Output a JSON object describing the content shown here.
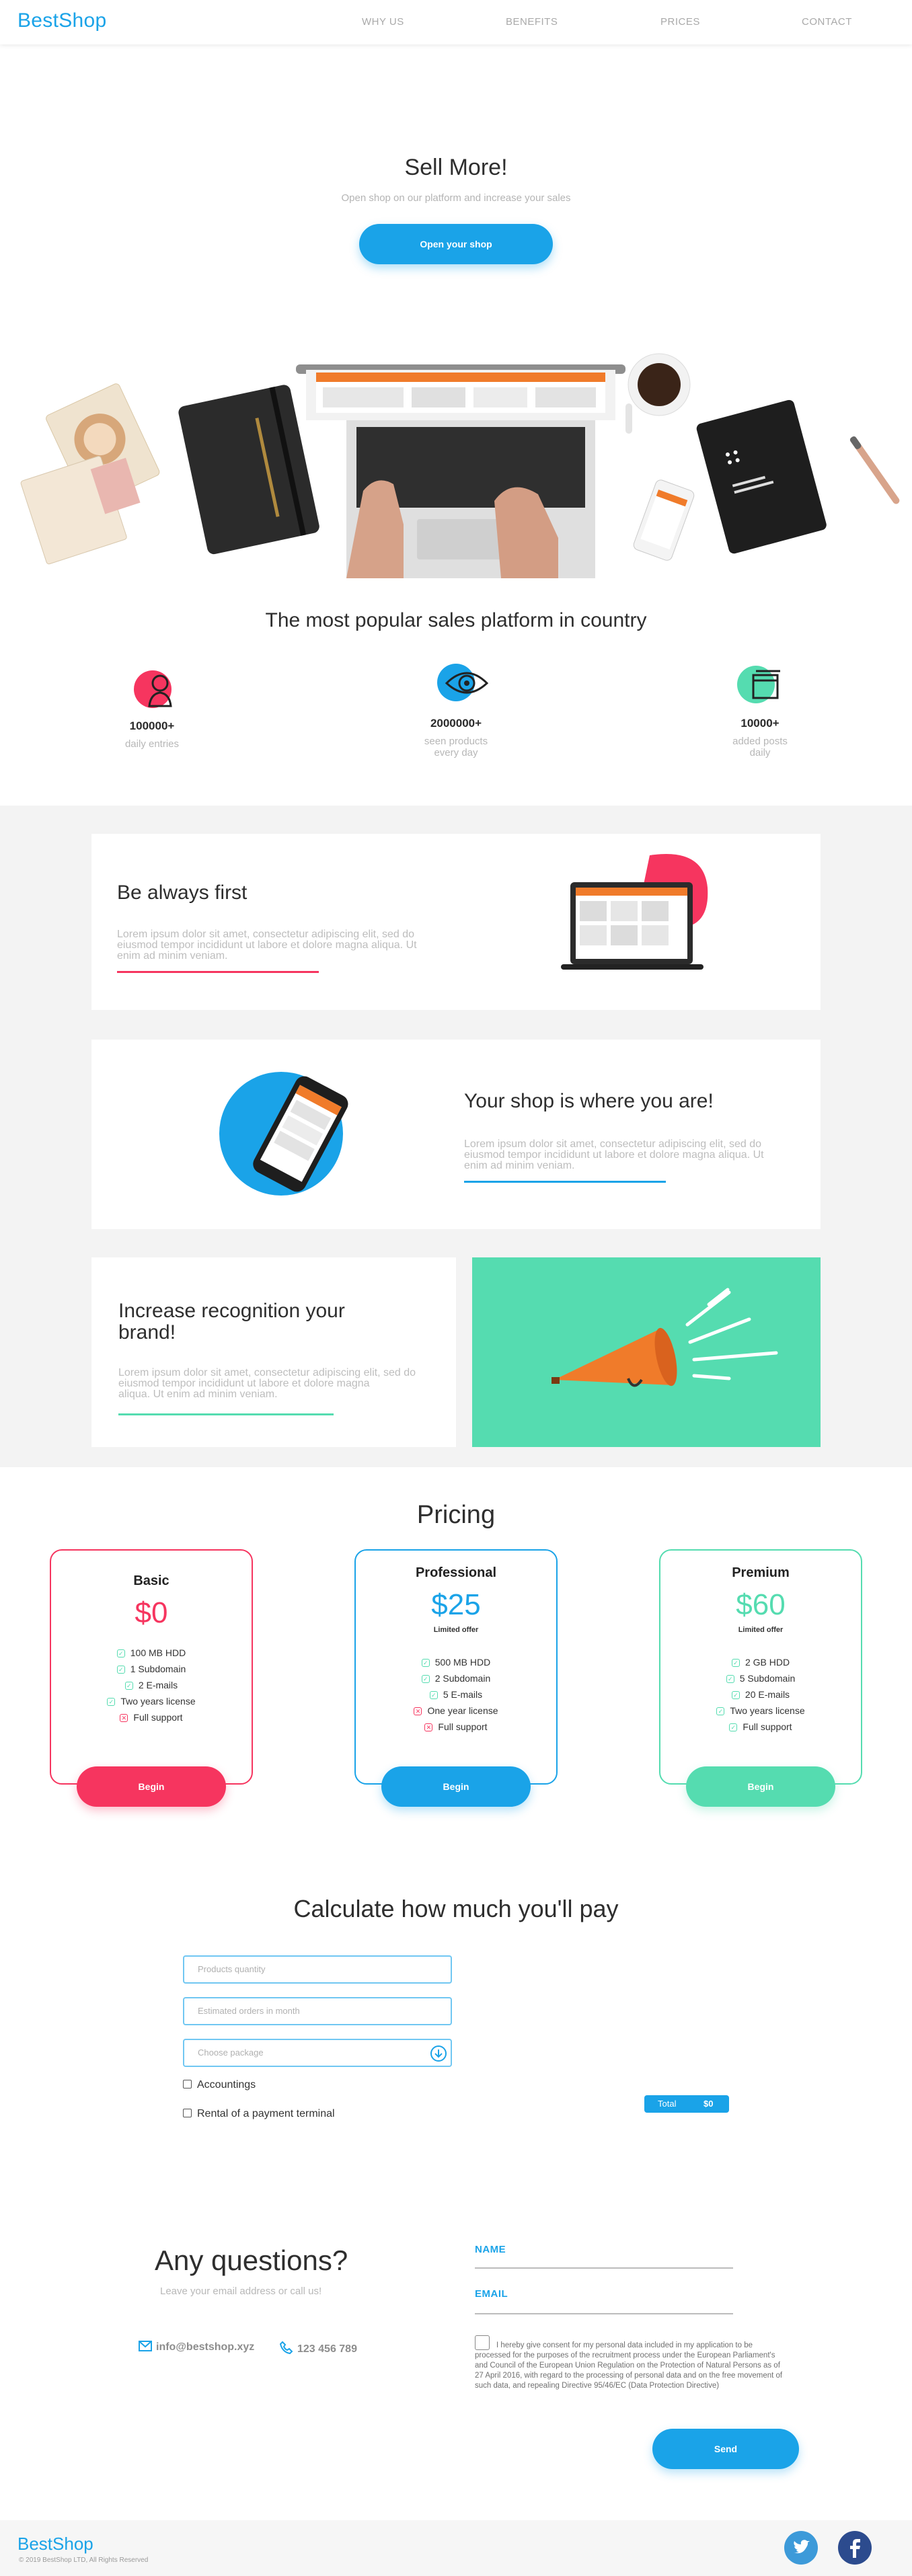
{
  "nav": {
    "logo": "BestShop",
    "links": [
      "WHY US",
      "BENEFITS",
      "PRICES",
      "CONTACT"
    ]
  },
  "hero": {
    "title": "Sell More!",
    "subtitle": "Open shop on our platform and increase your sales",
    "button": "Open your shop"
  },
  "stats": {
    "title": "The most popular sales platform in country",
    "items": [
      {
        "icon": "user-icon",
        "number": "100000+",
        "label_1": "daily entries",
        "label_2": ""
      },
      {
        "icon": "eye-icon",
        "number": "2000000+",
        "label_1": "seen products",
        "label_2": "every day"
      },
      {
        "icon": "posts-icon",
        "number": "10000+",
        "label_1": "added posts",
        "label_2": "daily"
      }
    ]
  },
  "benefits": [
    {
      "title": "Be always first",
      "text_1": "Lorem ipsum dolor sit amet, consectetur adipiscing elit, sed do",
      "text_2": "eiusmod tempor incididunt ut labore et dolore magna aliqua. Ut",
      "text_3": "enim ad minim veniam."
    },
    {
      "title": "Your shop is where you are!",
      "text_1": "Lorem ipsum dolor sit amet, consectetur adipiscing elit, sed do",
      "text_2": "eiusmod tempor incididunt ut labore et dolore magna aliqua. Ut",
      "text_3": "enim ad minim veniam."
    },
    {
      "title_1": "Increase recognition your",
      "title_2": "brand!",
      "text_1": "Lorem ipsum dolor sit amet, consectetur adipiscing elit, sed do",
      "text_2": "eiusmod tempor incididunt ut labore et dolore magna",
      "text_3": "aliqua. Ut enim ad minim veniam."
    }
  ],
  "pricing": {
    "title": "Pricing",
    "plans": [
      {
        "name": "Basic",
        "price": "$0",
        "note": "",
        "color": "#f6355f",
        "features": [
          "100 MB HDD",
          "1 Subdomain",
          "2 E-mails",
          "Two years license",
          "Full support"
        ],
        "button": "Begin"
      },
      {
        "name": "Professional",
        "price": "$25",
        "note": "Limited offer",
        "color": "#1aa3e8",
        "features": [
          "500 MB HDD",
          "2 Subdomain",
          "5 E-mails",
          "One year license",
          "Full support"
        ],
        "button": "Begin"
      },
      {
        "name": "Premium",
        "price": "$60",
        "note": "Limited offer",
        "color": "#55dcb0",
        "features": [
          "2 GB HDD",
          "5 Subdomain",
          "20 E-mails",
          "Two years license",
          "Full support"
        ],
        "button": "Begin"
      }
    ]
  },
  "calculator": {
    "title": "Calculate how much you'll pay",
    "products_placeholder": "Products quantity",
    "orders_placeholder": "Estimated orders in month",
    "package_placeholder": "Choose package",
    "accounting": "Accountings",
    "terminal": "Rental of a payment terminal",
    "total_label": "Total",
    "total_value": "$0"
  },
  "contact": {
    "title": "Any questions?",
    "subtitle": "Leave your email address or call us!",
    "email": "info@bestshop.xyz",
    "phone": "123 456 789",
    "name_label": "NAME",
    "email_label": "EMAIL",
    "consent": "I hereby give consent for my personal data included in my application to be processed for the purposes of the recruitment process under the European Parliament's and Council of the European Union Regulation on the Protection of Natural Persons as of 27 April 2016, with regard to the processing of personal data and on the free movement of such data, and repealing Directive 95/46/EC (Data Protection Directive)",
    "send": "Send"
  },
  "footer": {
    "logo": "BestShop",
    "copyright": "© 2019 BestShop LTD, All Rights Reserved",
    "twitter_color": "#3d9ad9",
    "facebook_color": "#2c4b8e"
  }
}
